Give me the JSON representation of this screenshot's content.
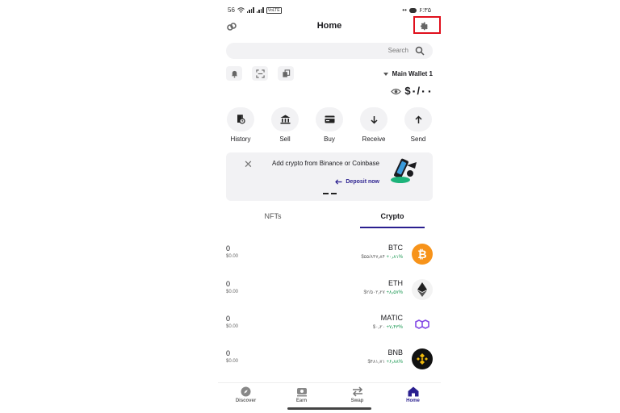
{
  "status_bar": {
    "left_text": "56",
    "volte": "VoLTE",
    "time": "۶:۳۵"
  },
  "header": {
    "title": "Home"
  },
  "search": {
    "placeholder": "Search"
  },
  "wallet": {
    "name": "Main Wallet 1",
    "balance": "$۰/۰۰"
  },
  "actions": [
    {
      "label": "History",
      "icon": "history-icon"
    },
    {
      "label": "Sell",
      "icon": "bank-icon"
    },
    {
      "label": "Buy",
      "icon": "card-icon"
    },
    {
      "label": "Receive",
      "icon": "arrow-down-icon"
    },
    {
      "label": "Send",
      "icon": "arrow-up-icon"
    }
  ],
  "banner": {
    "text": "Add crypto from Binance or Coinbase",
    "link": "Deposit now"
  },
  "tabs": {
    "nfts": "NFTs",
    "crypto": "Crypto"
  },
  "assets": [
    {
      "amount": "0",
      "usd": "$0.00",
      "symbol": "BTC",
      "price": "$۵۵/۸۴۷٫۸۴",
      "change": "+۰٫۸۱%",
      "color": "#f7931a"
    },
    {
      "amount": "0",
      "usd": "$0.00",
      "symbol": "ETH",
      "price": "$۲/۵۰۲٫۲۷",
      "change": "+۸٫۵۷%",
      "color": "#627eea"
    },
    {
      "amount": "0",
      "usd": "$0.00",
      "symbol": "MATIC",
      "price": "$۰٫۲۰",
      "change": "+۷٫۴۳%",
      "color": "#8247e5"
    },
    {
      "amount": "0",
      "usd": "$0.00",
      "symbol": "BNB",
      "price": "$۴۸۱٫۷۱",
      "change": "+۶٫۸۸%",
      "color": "#f0b90b"
    }
  ],
  "nav": [
    {
      "label": "Discover",
      "icon": "compass-icon"
    },
    {
      "label": "Earn",
      "icon": "earn-icon"
    },
    {
      "label": "Swap",
      "icon": "swap-icon"
    },
    {
      "label": "Home",
      "icon": "home-icon"
    }
  ],
  "colors": {
    "accent": "#2a1f8f",
    "highlight": "#e0101d",
    "positive": "#1e9a55"
  }
}
